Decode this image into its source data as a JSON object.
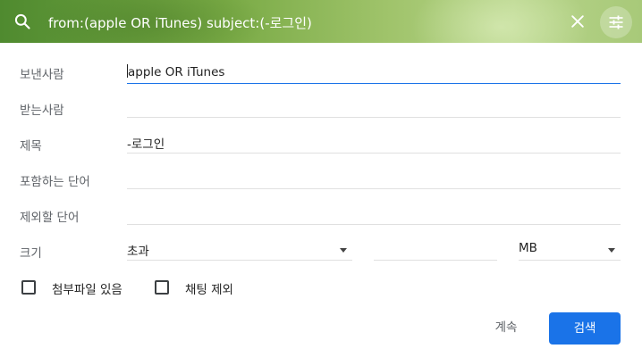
{
  "search": {
    "query": "from:(apple OR iTunes) subject:(-로그인)"
  },
  "form": {
    "from": {
      "label": "보낸사람",
      "value": "apple OR iTunes"
    },
    "to": {
      "label": "받는사람",
      "value": ""
    },
    "subject": {
      "label": "제목",
      "value": "-로그인"
    },
    "has_words": {
      "label": "포함하는 단어",
      "value": ""
    },
    "doesnt_have": {
      "label": "제외할 단어",
      "value": ""
    },
    "size": {
      "label": "크기",
      "comparator": "초과",
      "amount": "",
      "unit": "MB"
    }
  },
  "checkboxes": {
    "has_attachment": {
      "label": "첨부파일 있음",
      "checked": false
    },
    "exclude_chats": {
      "label": "채팅 제외",
      "checked": false
    }
  },
  "actions": {
    "cancel_label": "계속",
    "search_label": "검색"
  },
  "colors": {
    "accent": "#1a73e8"
  },
  "icons": [
    "search-icon",
    "close-icon",
    "tune-icon",
    "dropdown-arrow-icon"
  ]
}
